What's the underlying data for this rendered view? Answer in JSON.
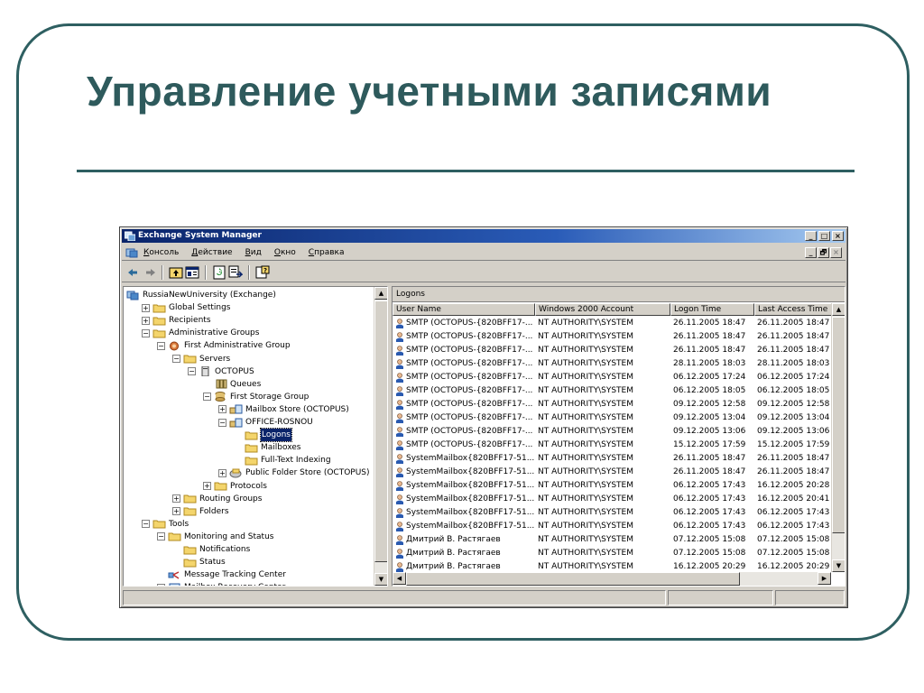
{
  "slide": {
    "title": "Управление учетными записями"
  },
  "window": {
    "title": "Exchange System Manager",
    "controls": [
      "_",
      "□",
      "×"
    ],
    "menu": [
      "Консоль",
      "Действие",
      "Вид",
      "Окно",
      "Справка"
    ],
    "mdi_controls": [
      "_",
      "🗗",
      "×"
    ],
    "toolbar_icons": [
      "back-arrow-icon",
      "forward-arrow-icon",
      "up-folder-icon",
      "show-hide-tree-icon",
      "refresh-icon",
      "export-list-icon",
      "help-icon"
    ]
  },
  "tree": {
    "nodes": [
      {
        "label": "RussiaNewUniversity (Exchange)",
        "icon": "exchange-org-icon",
        "expander": ""
      },
      {
        "label": "Global Settings",
        "icon": "folder-icon",
        "expander": "+"
      },
      {
        "label": "Recipients",
        "icon": "folder-icon",
        "expander": "+"
      },
      {
        "label": "Administrative Groups",
        "icon": "folder-icon",
        "expander": "−"
      },
      {
        "label": "First Administrative Group",
        "icon": "admin-group-icon",
        "expander": "−"
      },
      {
        "label": "Servers",
        "icon": "folder-icon",
        "expander": "−"
      },
      {
        "label": "OCTOPUS",
        "icon": "server-icon",
        "expander": "−"
      },
      {
        "label": "Queues",
        "icon": "queues-icon",
        "expander": ""
      },
      {
        "label": "First Storage Group",
        "icon": "storage-group-icon",
        "expander": "−"
      },
      {
        "label": "Mailbox Store (OCTOPUS)",
        "icon": "mailbox-store-icon",
        "expander": "+"
      },
      {
        "label": "OFFICE-ROSNOU",
        "icon": "mailbox-store-icon",
        "expander": "−"
      },
      {
        "label": "Logons",
        "icon": "folder-icon",
        "expander": "",
        "selected": true
      },
      {
        "label": "Mailboxes",
        "icon": "folder-icon",
        "expander": ""
      },
      {
        "label": "Full-Text Indexing",
        "icon": "folder-icon",
        "expander": ""
      },
      {
        "label": "Public Folder Store (OCTOPUS)",
        "icon": "public-store-icon",
        "expander": "+"
      },
      {
        "label": "Protocols",
        "icon": "folder-icon",
        "expander": "+"
      },
      {
        "label": "Routing Groups",
        "icon": "folder-icon",
        "expander": "+"
      },
      {
        "label": "Folders",
        "icon": "folder-icon",
        "expander": "+"
      },
      {
        "label": "Tools",
        "icon": "folder-icon",
        "expander": "−"
      },
      {
        "label": "Monitoring and Status",
        "icon": "folder-icon",
        "expander": "−"
      },
      {
        "label": "Notifications",
        "icon": "folder-icon",
        "expander": ""
      },
      {
        "label": "Status",
        "icon": "folder-icon",
        "expander": ""
      },
      {
        "label": "Message Tracking Center",
        "icon": "tracking-center-icon",
        "expander": ""
      },
      {
        "label": "Mailbox Recovery Center",
        "icon": "recovery-center-icon",
        "expander": "+"
      }
    ]
  },
  "list": {
    "heading": "Logons",
    "columns": [
      "User Name",
      "Windows 2000 Account",
      "Logon Time",
      "Last Access Time"
    ],
    "rows": [
      [
        "SMTP (OCTOPUS-{820BFF17-...",
        "NT AUTHORITY\\SYSTEM",
        "26.11.2005 18:47",
        "26.11.2005 18:47"
      ],
      [
        "SMTP (OCTOPUS-{820BFF17-...",
        "NT AUTHORITY\\SYSTEM",
        "26.11.2005 18:47",
        "26.11.2005 18:47"
      ],
      [
        "SMTP (OCTOPUS-{820BFF17-...",
        "NT AUTHORITY\\SYSTEM",
        "26.11.2005 18:47",
        "26.11.2005 18:47"
      ],
      [
        "SMTP (OCTOPUS-{820BFF17-...",
        "NT AUTHORITY\\SYSTEM",
        "28.11.2005 18:03",
        "28.11.2005 18:03"
      ],
      [
        "SMTP (OCTOPUS-{820BFF17-...",
        "NT AUTHORITY\\SYSTEM",
        "06.12.2005 17:24",
        "06.12.2005 17:24"
      ],
      [
        "SMTP (OCTOPUS-{820BFF17-...",
        "NT AUTHORITY\\SYSTEM",
        "06.12.2005 18:05",
        "06.12.2005 18:05"
      ],
      [
        "SMTP (OCTOPUS-{820BFF17-...",
        "NT AUTHORITY\\SYSTEM",
        "09.12.2005 12:58",
        "09.12.2005 12:58"
      ],
      [
        "SMTP (OCTOPUS-{820BFF17-...",
        "NT AUTHORITY\\SYSTEM",
        "09.12.2005 13:04",
        "09.12.2005 13:04"
      ],
      [
        "SMTP (OCTOPUS-{820BFF17-...",
        "NT AUTHORITY\\SYSTEM",
        "09.12.2005 13:06",
        "09.12.2005 13:06"
      ],
      [
        "SMTP (OCTOPUS-{820BFF17-...",
        "NT AUTHORITY\\SYSTEM",
        "15.12.2005 17:59",
        "15.12.2005 17:59"
      ],
      [
        "SystemMailbox{820BFF17-51...",
        "NT AUTHORITY\\SYSTEM",
        "26.11.2005 18:47",
        "26.11.2005 18:47"
      ],
      [
        "SystemMailbox{820BFF17-51...",
        "NT AUTHORITY\\SYSTEM",
        "26.11.2005 18:47",
        "26.11.2005 18:47"
      ],
      [
        "SystemMailbox{820BFF17-51...",
        "NT AUTHORITY\\SYSTEM",
        "06.12.2005 17:43",
        "16.12.2005 20:28"
      ],
      [
        "SystemMailbox{820BFF17-51...",
        "NT AUTHORITY\\SYSTEM",
        "06.12.2005 17:43",
        "16.12.2005 20:41"
      ],
      [
        "SystemMailbox{820BFF17-51...",
        "NT AUTHORITY\\SYSTEM",
        "06.12.2005 17:43",
        "06.12.2005 17:43"
      ],
      [
        "SystemMailbox{820BFF17-51...",
        "NT AUTHORITY\\SYSTEM",
        "06.12.2005 17:43",
        "06.12.2005 17:43"
      ],
      [
        "Дмитрий В. Растягаев",
        "NT AUTHORITY\\SYSTEM",
        "07.12.2005 15:08",
        "07.12.2005 15:08"
      ],
      [
        "Дмитрий В. Растягаев",
        "NT AUTHORITY\\SYSTEM",
        "07.12.2005 15:08",
        "07.12.2005 15:08"
      ],
      [
        "Дмитрий В. Растягаев",
        "NT AUTHORITY\\SYSTEM",
        "16.12.2005 20:29",
        "16.12.2005 20:29"
      ]
    ]
  },
  "colors": {
    "accent": "#2e5f61",
    "titlebar_start": "#0a246a",
    "titlebar_end": "#a6caf0",
    "chrome": "#d4d0c8"
  }
}
